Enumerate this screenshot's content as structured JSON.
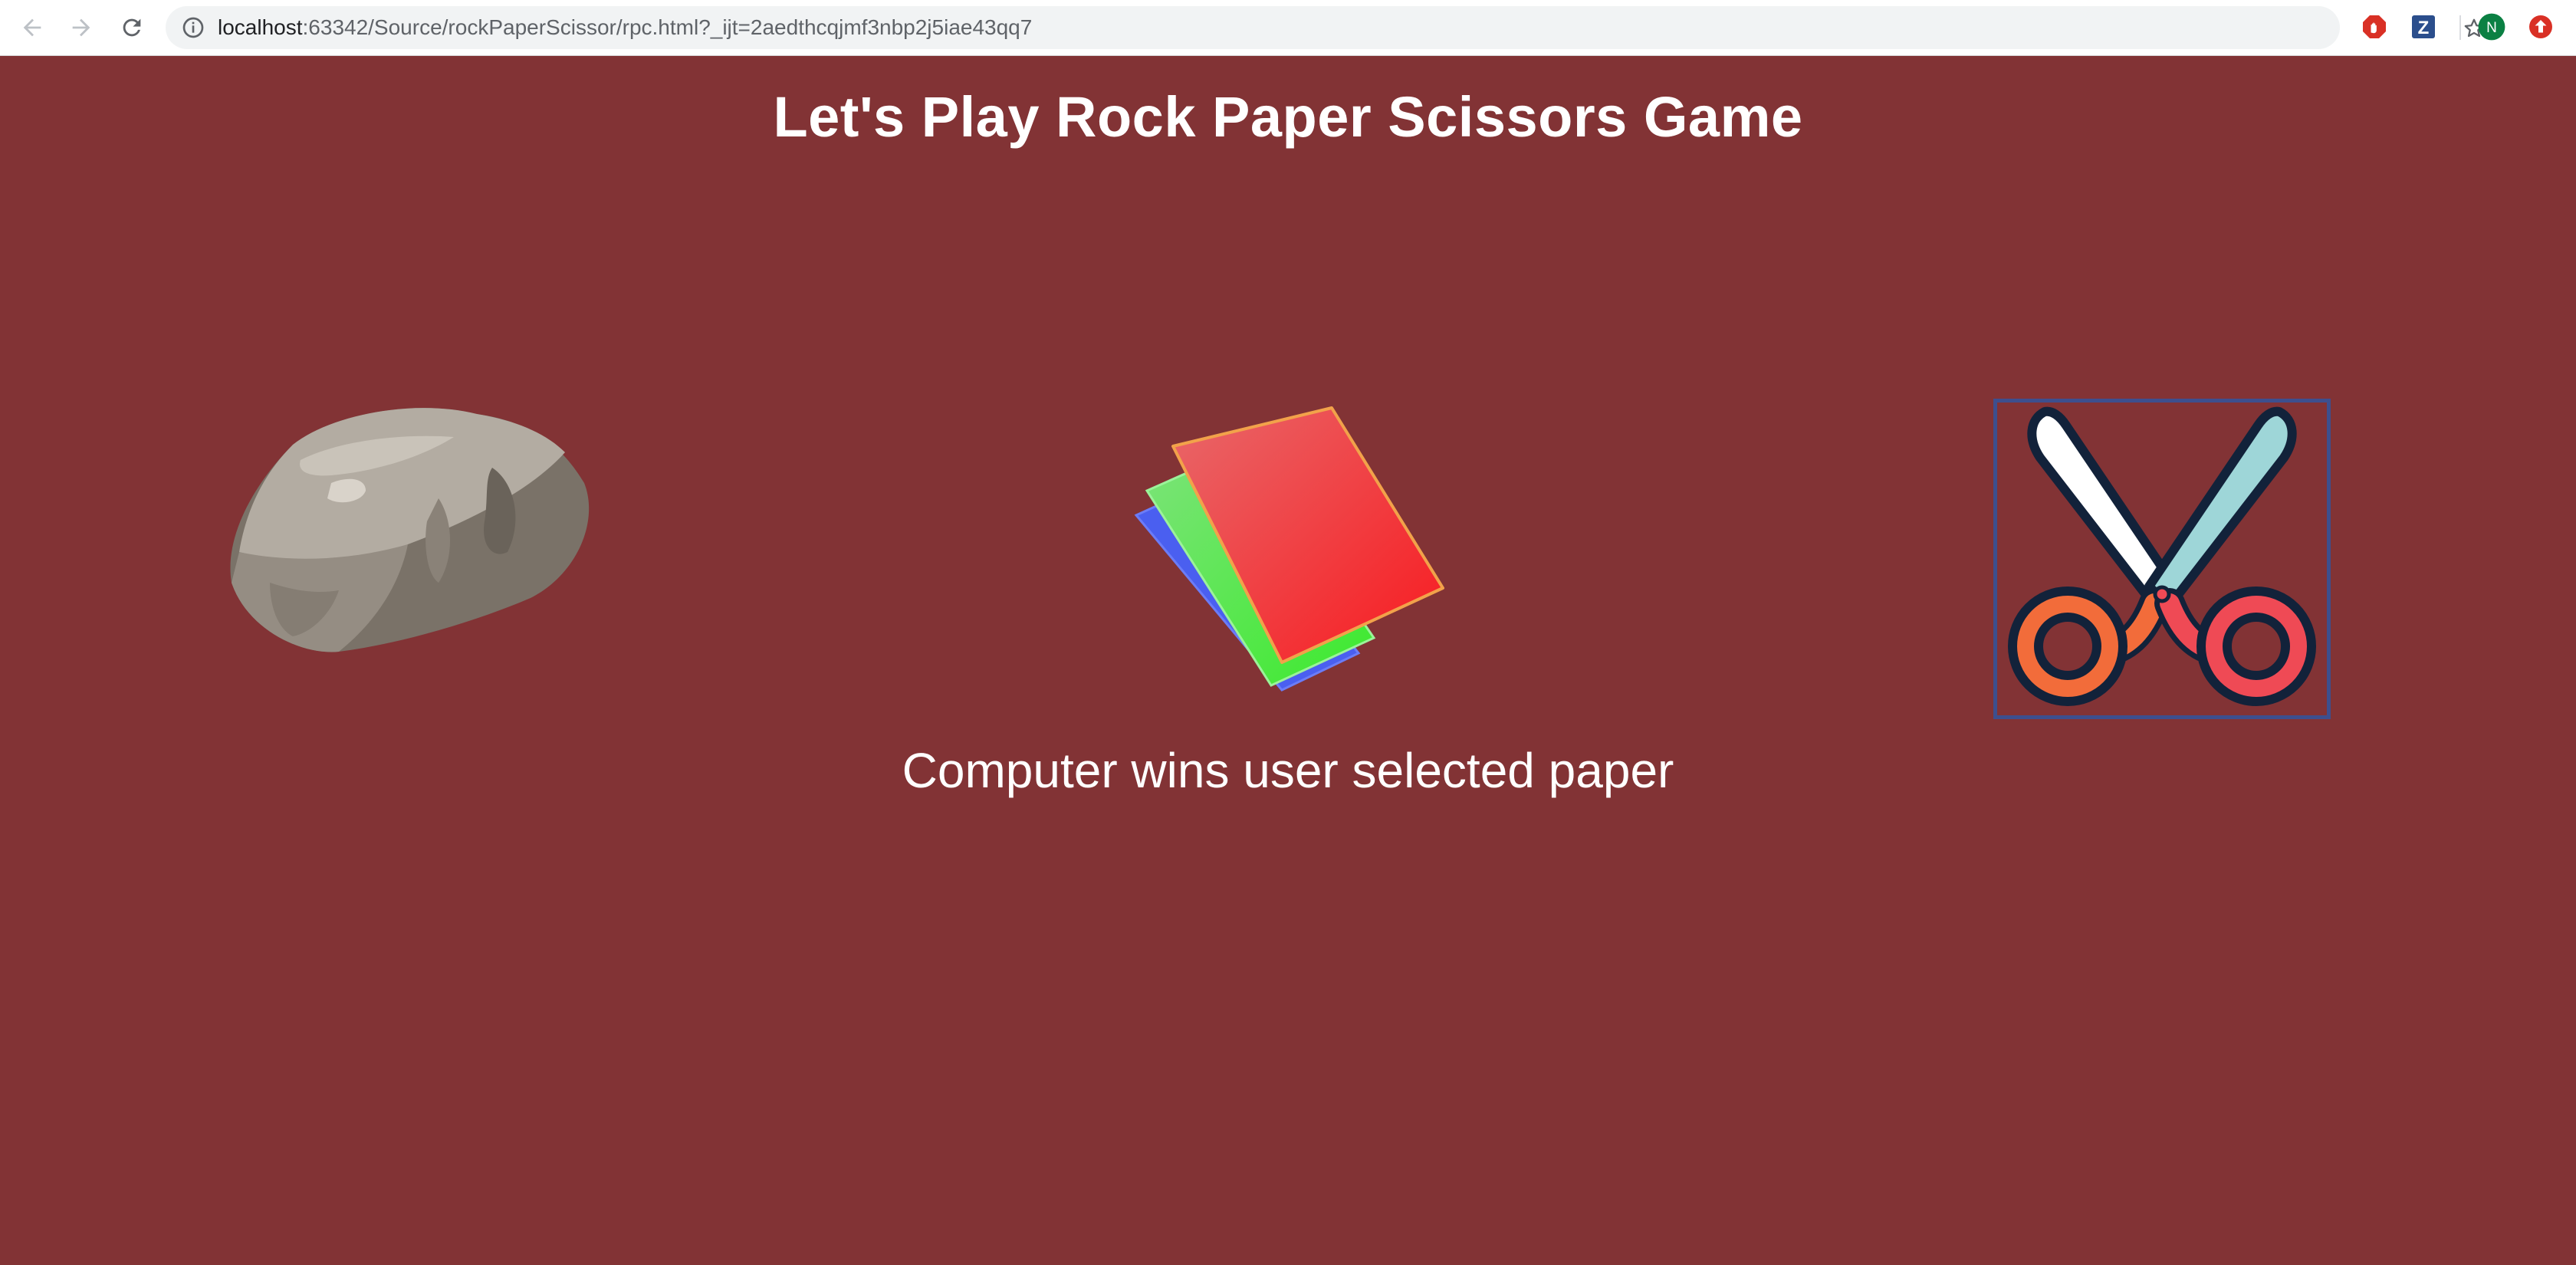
{
  "browser": {
    "url_host": "localhost",
    "url_path": ":63342/Source/rockPaperScissor/rpc.html?_ijt=2aedthcqjmf3nbp2j5iae43qq7",
    "icons": [
      "back-icon",
      "forward-icon",
      "reload-icon",
      "info-icon",
      "star-icon"
    ],
    "extensions": [
      {
        "name": "adblock-extension-icon",
        "color": "#d93025"
      },
      {
        "name": "zotero-extension-icon",
        "label": "Z",
        "color": "#2b4e8c"
      },
      {
        "name": "profile-avatar",
        "label": "N",
        "color": "#0b8043"
      },
      {
        "name": "update-extension-icon",
        "color": "#d93025"
      }
    ]
  },
  "game": {
    "title": "Let's Play Rock Paper Scissors Game",
    "choices": [
      {
        "id": "rock",
        "icon": "rock-icon"
      },
      {
        "id": "paper",
        "icon": "paper-icon"
      },
      {
        "id": "scissors",
        "icon": "scissors-icon",
        "highlighted": true
      }
    ],
    "result": "Computer wins user selected paper"
  },
  "colors": {
    "background": "#823335",
    "text": "#ffffff",
    "highlight_border": "#3d4f8e"
  }
}
